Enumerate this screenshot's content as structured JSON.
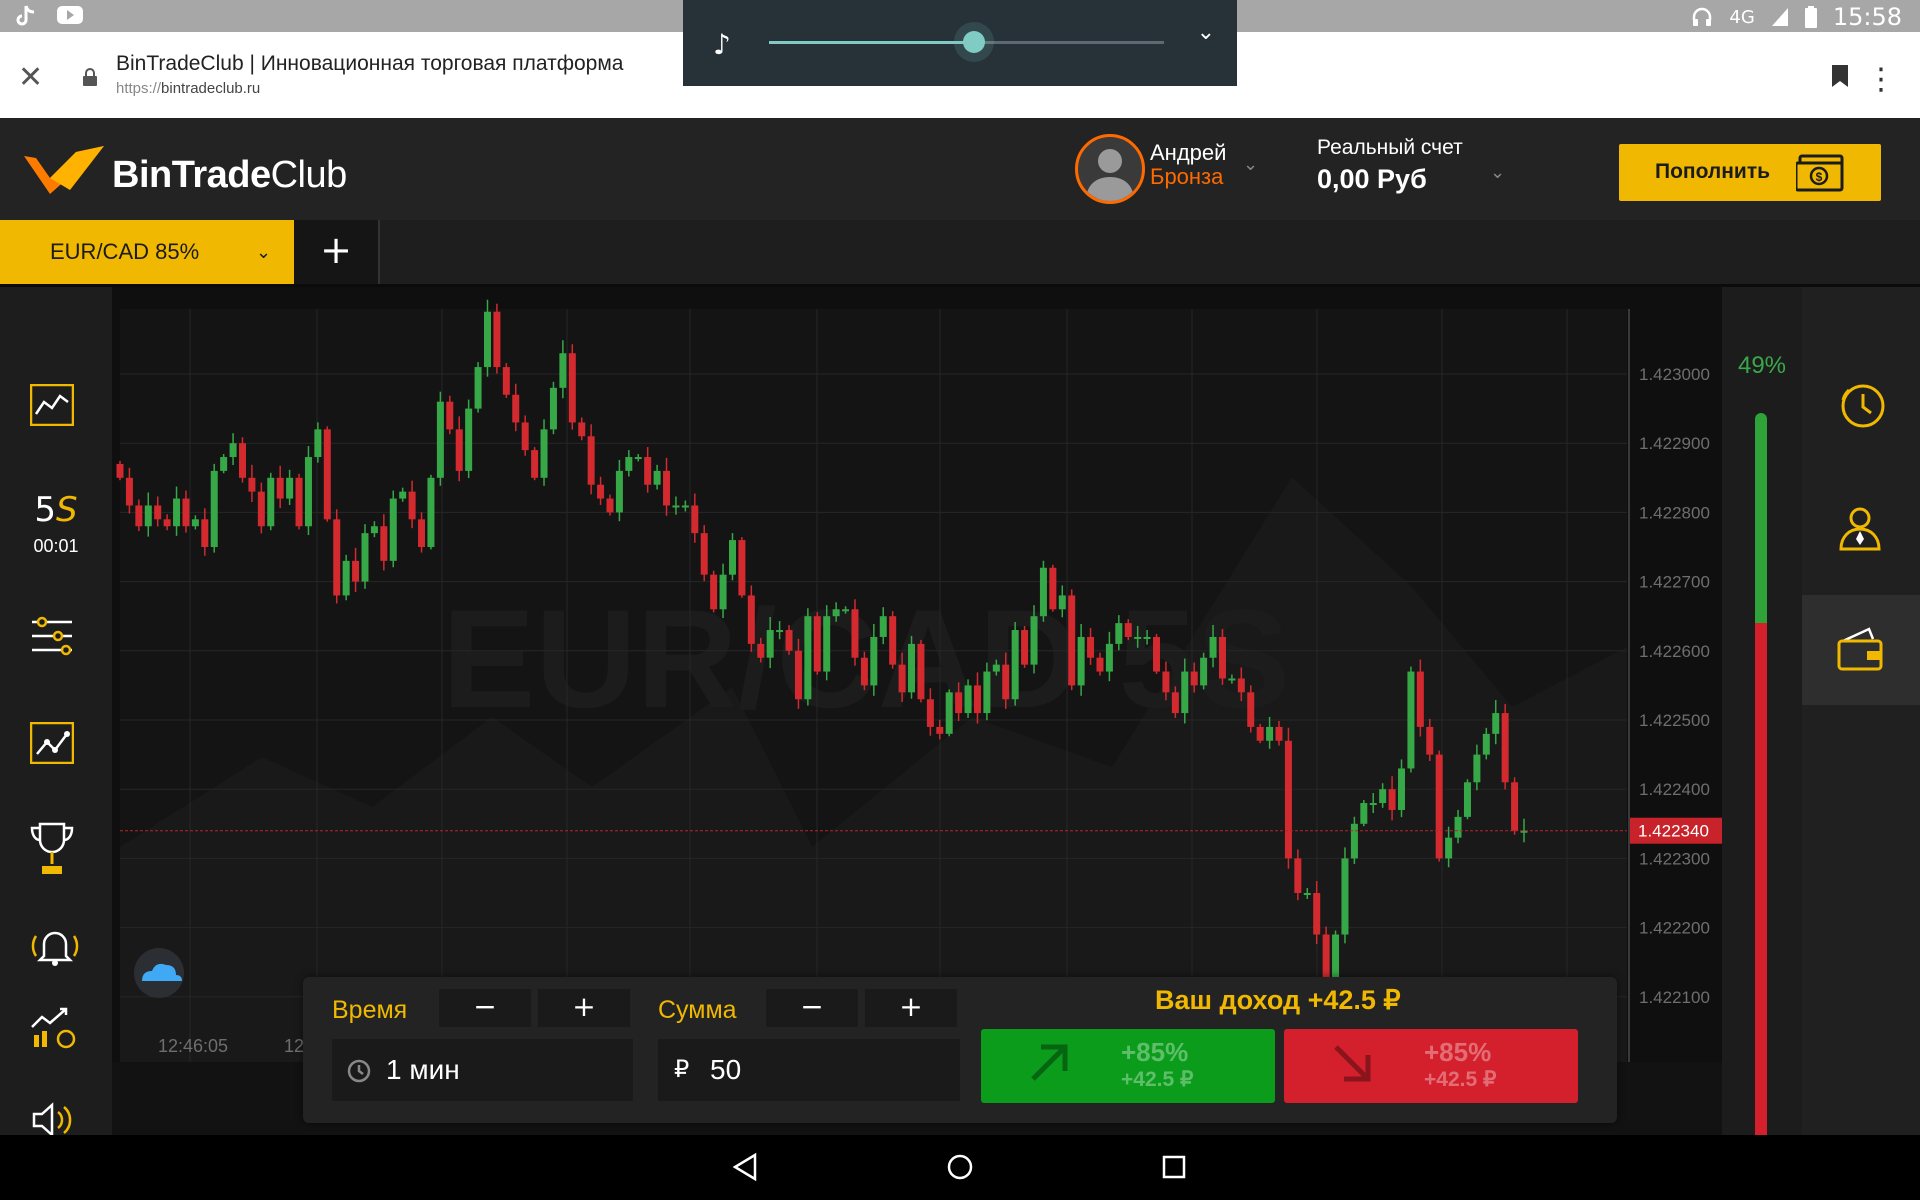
{
  "status_bar": {
    "time": "15:58",
    "network": "4G",
    "left_icons": [
      "tiktok-icon",
      "youtube-icon"
    ],
    "right_icons": [
      "headphones-icon",
      "signal-icon",
      "battery-icon"
    ]
  },
  "browser": {
    "title": "BinTradeClub | Инновационная торговая платформа",
    "url_protocol": "https://",
    "url_host": "bintradeclub.ru"
  },
  "media": {
    "progress": 0.52
  },
  "header": {
    "logo_bold": "BinTrade",
    "logo_light": "Club",
    "user_name": "Андрей",
    "user_rank": "Бронза",
    "account_label": "Реальный счет",
    "account_value": "0,00 Руб",
    "deposit_label": "Пополнить"
  },
  "tabs": {
    "pair": "EUR/CAD 85%",
    "add": "+"
  },
  "left_bar": {
    "timeframe_value": "5",
    "timeframe_unit": "S",
    "timeframe_timer": "00:01",
    "icons": [
      "chart-type-icon",
      "indicators-icon",
      "drawing-tools-icon",
      "tournament-trophy-icon",
      "alerts-bell-icon",
      "signals-icon",
      "sound-icon"
    ]
  },
  "sentiment": {
    "up_percent_label": "49%",
    "up_fraction": 0.49
  },
  "right_bar": {
    "icons": [
      "history-clock-icon",
      "profile-user-icon",
      "wallet-icon"
    ]
  },
  "trade": {
    "time_label": "Время",
    "time_value": "1 мин",
    "amount_label": "Сумма",
    "currency": "₽",
    "amount_value": "50",
    "minus": "−",
    "plus": "+",
    "income_text": "Ваш доход +42.5 ₽",
    "call_percent": "+85%",
    "call_amount": "+42.5 ₽",
    "put_percent": "+85%",
    "put_amount": "+42.5 ₽"
  },
  "chart_data": {
    "type": "candlestick",
    "watermark": "EUR/CAD 5S",
    "y_ticks": [
      1.423,
      1.4229,
      1.4228,
      1.4227,
      1.4226,
      1.4225,
      1.4224,
      1.4223,
      1.4222,
      1.4221
    ],
    "y_tick_labels": [
      "1.423000",
      "1.422900",
      "1.422800",
      "1.422700",
      "1.422600",
      "1.422500",
      "1.422400",
      "1.422300",
      "1.422200",
      "1.422100"
    ],
    "ylim": [
      1.42208,
      1.42306
    ],
    "current_price": 1.42234,
    "current_price_label": "1.422340",
    "x_tick_labels": [
      "12:46:05",
      "12"
    ],
    "candle_count": 150,
    "closes_approx": [
      1.42285,
      1.42281,
      1.42278,
      1.42281,
      1.42279,
      1.42278,
      1.42282,
      1.42278,
      1.42279,
      1.42275,
      1.42286,
      1.42288,
      1.4229,
      1.42285,
      1.42283,
      1.42278,
      1.42285,
      1.42282,
      1.42285,
      1.42278,
      1.42288,
      1.42292,
      1.42279,
      1.42268,
      1.42273,
      1.4227,
      1.42277,
      1.42278,
      1.42273,
      1.42282,
      1.42283,
      1.42279,
      1.42275,
      1.42285,
      1.42296,
      1.42292,
      1.42286,
      1.42295,
      1.42301,
      1.42309,
      1.42301,
      1.42297,
      1.42293,
      1.42289,
      1.42285,
      1.42292,
      1.42298,
      1.42303,
      1.42293,
      1.42291,
      1.42284,
      1.42282,
      1.4228,
      1.42286,
      1.42288,
      1.42288,
      1.42284,
      1.42286,
      1.42281,
      1.42281,
      1.42281,
      1.42277,
      1.42271,
      1.42266,
      1.42271,
      1.42276,
      1.42268,
      1.42261,
      1.42259,
      1.42263,
      1.42263,
      1.4226,
      1.42253,
      1.42265,
      1.42257,
      1.42265,
      1.42266,
      1.42266,
      1.42259,
      1.42255,
      1.42262,
      1.42265,
      1.42258,
      1.42254,
      1.42261,
      1.42253,
      1.42249,
      1.42248,
      1.42254,
      1.42251,
      1.42255,
      1.42251,
      1.42257,
      1.42258,
      1.42253,
      1.42263,
      1.42258,
      1.42265,
      1.42272,
      1.42266,
      1.42268,
      1.42255,
      1.42262,
      1.42259,
      1.42257,
      1.42261,
      1.42264,
      1.42262,
      1.42262,
      1.42262,
      1.42257,
      1.42254,
      1.42251,
      1.42257,
      1.42255,
      1.42259,
      1.42262,
      1.42256,
      1.42256,
      1.42254,
      1.42249,
      1.42247,
      1.42249,
      1.42247,
      1.4223,
      1.42225,
      1.42225,
      1.42219,
      1.42208,
      1.42219,
      1.4223,
      1.42235,
      1.42238,
      1.42238,
      1.4224,
      1.42237,
      1.42243,
      1.42257,
      1.42249,
      1.42245,
      1.4223,
      1.42233,
      1.42236,
      1.42241,
      1.42245,
      1.42248,
      1.42251,
      1.42241,
      1.42234,
      1.42234
    ]
  }
}
